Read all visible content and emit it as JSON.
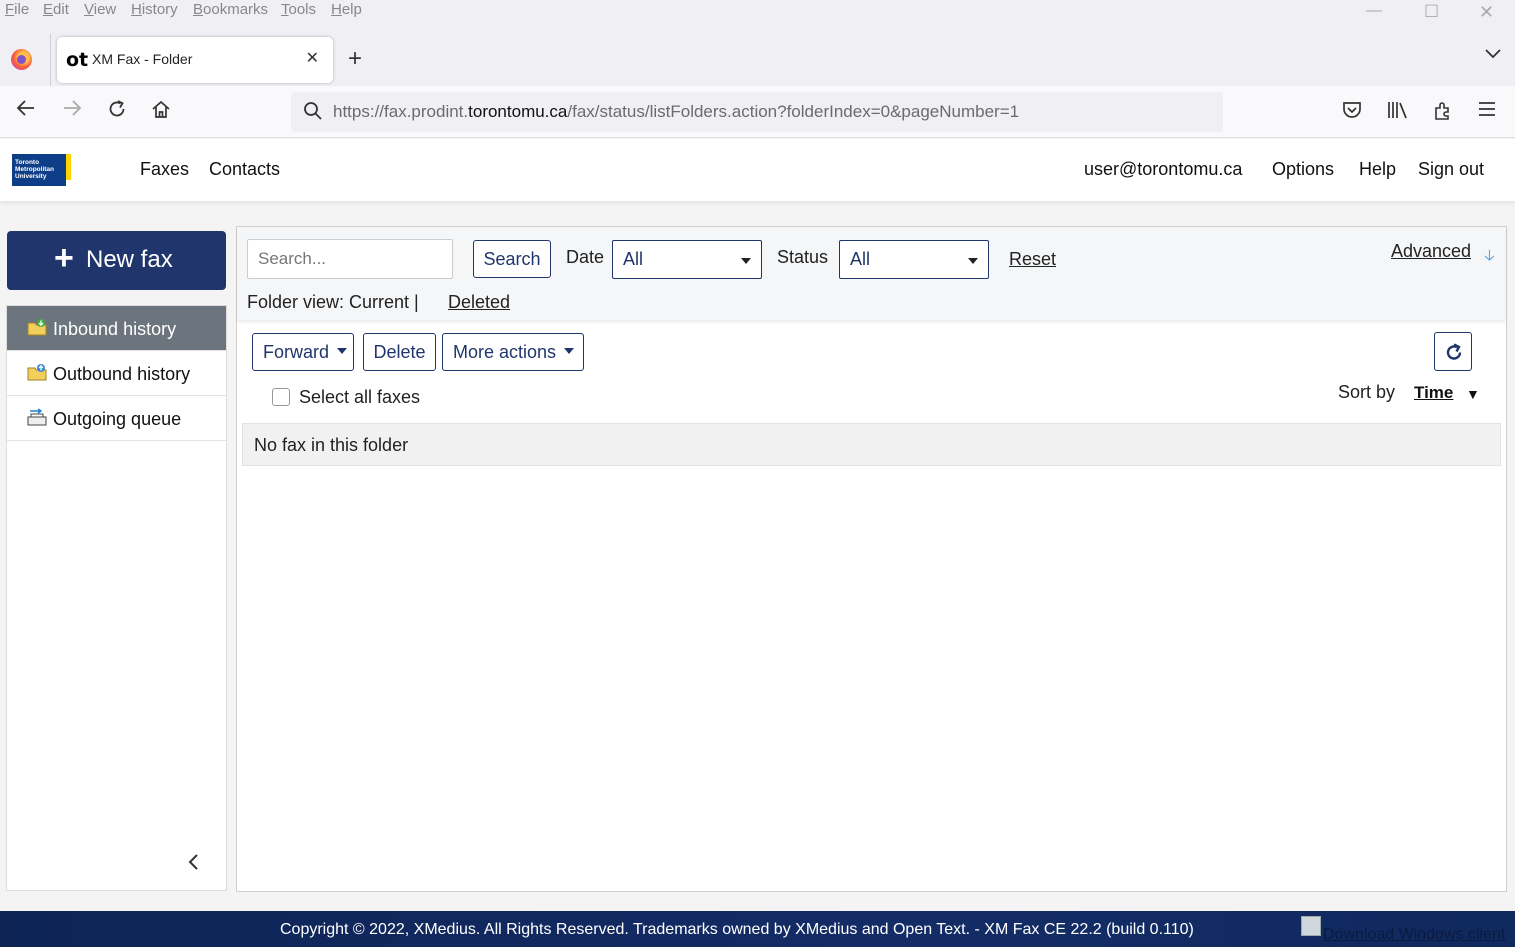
{
  "browser": {
    "menu": [
      "File",
      "Edit",
      "View",
      "History",
      "Bookmarks",
      "Tools",
      "Help"
    ],
    "tab": {
      "favicon_text": "ot",
      "title": "XM Fax - Folder"
    },
    "url": {
      "prefix": "https://fax.prodint.",
      "domain": "torontomu.ca",
      "path": "/fax/status/listFolders.action?folderIndex=0&pageNumber=1"
    }
  },
  "header": {
    "logo_lines": [
      "Toronto",
      "Metropolitan",
      "University"
    ],
    "nav": [
      "Faxes",
      "Contacts"
    ],
    "user": "user@torontomu.ca",
    "options": "Options",
    "help": "Help",
    "signout": "Sign out"
  },
  "sidebar": {
    "new_fax": "New fax",
    "items": [
      {
        "label": "Inbound history",
        "icon": "folder-inbound-icon",
        "active": true
      },
      {
        "label": "Outbound history",
        "icon": "folder-outbound-icon",
        "active": false
      },
      {
        "label": "Outgoing queue",
        "icon": "queue-icon",
        "active": false
      }
    ]
  },
  "filters": {
    "search_placeholder": "Search...",
    "search_button": "Search",
    "date_label": "Date",
    "date_value": "All",
    "status_label": "Status",
    "status_value": "All",
    "reset": "Reset",
    "advanced": "Advanced",
    "folder_view_label": "Folder view: Current |",
    "deleted": "Deleted"
  },
  "toolbar": {
    "forward": "Forward",
    "delete": "Delete",
    "more_actions": "More actions",
    "select_all": "Select all faxes",
    "sort_by": "Sort by",
    "sort_key": "Time"
  },
  "list": {
    "empty_message": "No fax in this folder"
  },
  "footer": {
    "copyright": "Copyright © 2022, XMedius. All Rights Reserved. Trademarks owned by XMedius and Open Text. - XM Fax CE 22.2 (build 0.110)",
    "download": "Download Windows client"
  },
  "colors": {
    "brand_navy": "#1f356b",
    "active_gray": "#6c757d",
    "logo_blue": "#0f3e88",
    "logo_yellow": "#ffd200"
  }
}
